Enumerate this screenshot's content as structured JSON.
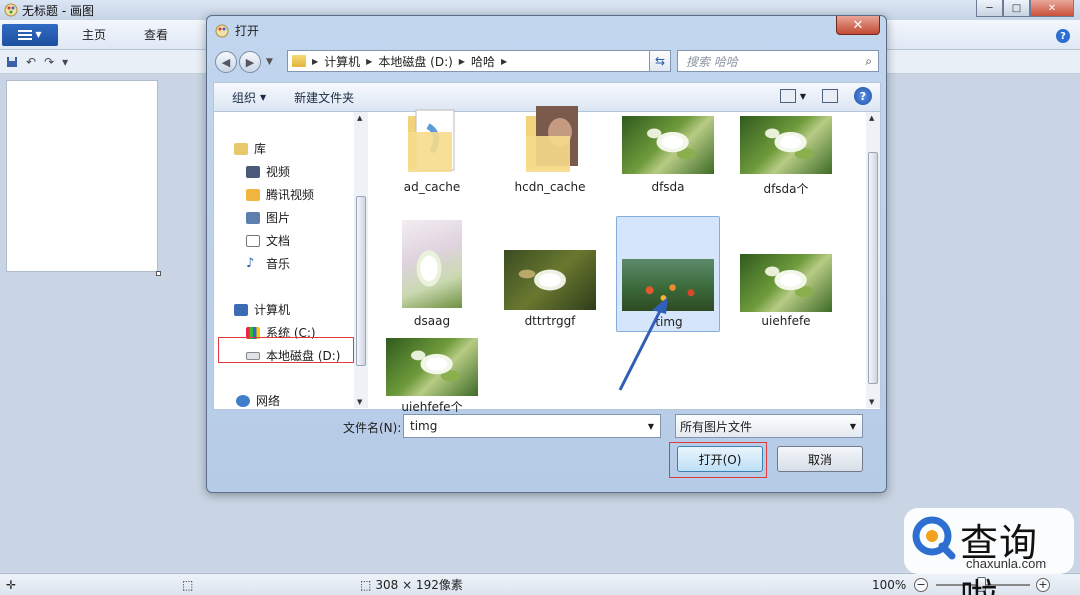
{
  "paint": {
    "title": "无标题 - 画图",
    "tabs": [
      "主页",
      "查看"
    ],
    "help": "?",
    "status": {
      "size": "308 × 192像素",
      "zoom": "100%"
    }
  },
  "dialog": {
    "title": "打开",
    "close": "✕",
    "breadcrumb": [
      "计算机",
      "本地磁盘 (D:)",
      "哈哈"
    ],
    "search_placeholder": "搜索 哈哈",
    "toolbar": {
      "organize": "组织",
      "new_folder": "新建文件夹"
    },
    "nav": {
      "library": "库",
      "video": "视频",
      "tencent_video": "腾讯视频",
      "pictures": "图片",
      "documents": "文档",
      "music": "音乐",
      "computer": "计算机",
      "system_c": "系统 (C:)",
      "local_d": "本地磁盘 (D:)",
      "network": "网络"
    },
    "files": [
      {
        "name": "ad_cache",
        "kind": "folder"
      },
      {
        "name": "hcdn_cache",
        "kind": "folder"
      },
      {
        "name": "dfsda",
        "kind": "image"
      },
      {
        "name": "dfsda个",
        "kind": "image"
      },
      {
        "name": "dsaag",
        "kind": "image"
      },
      {
        "name": "dttrtrggf",
        "kind": "image"
      },
      {
        "name": "timg",
        "kind": "image",
        "selected": true
      },
      {
        "name": "uiehfefe",
        "kind": "image"
      },
      {
        "name": "uiehfefe个",
        "kind": "image"
      }
    ],
    "filename_label": "文件名(N):",
    "filename_value": "timg",
    "filter": "所有图片文件",
    "open_button": "打开(O)",
    "cancel_button": "取消"
  },
  "watermark": {
    "title": "查询啦",
    "url": "chaxunla.com"
  }
}
